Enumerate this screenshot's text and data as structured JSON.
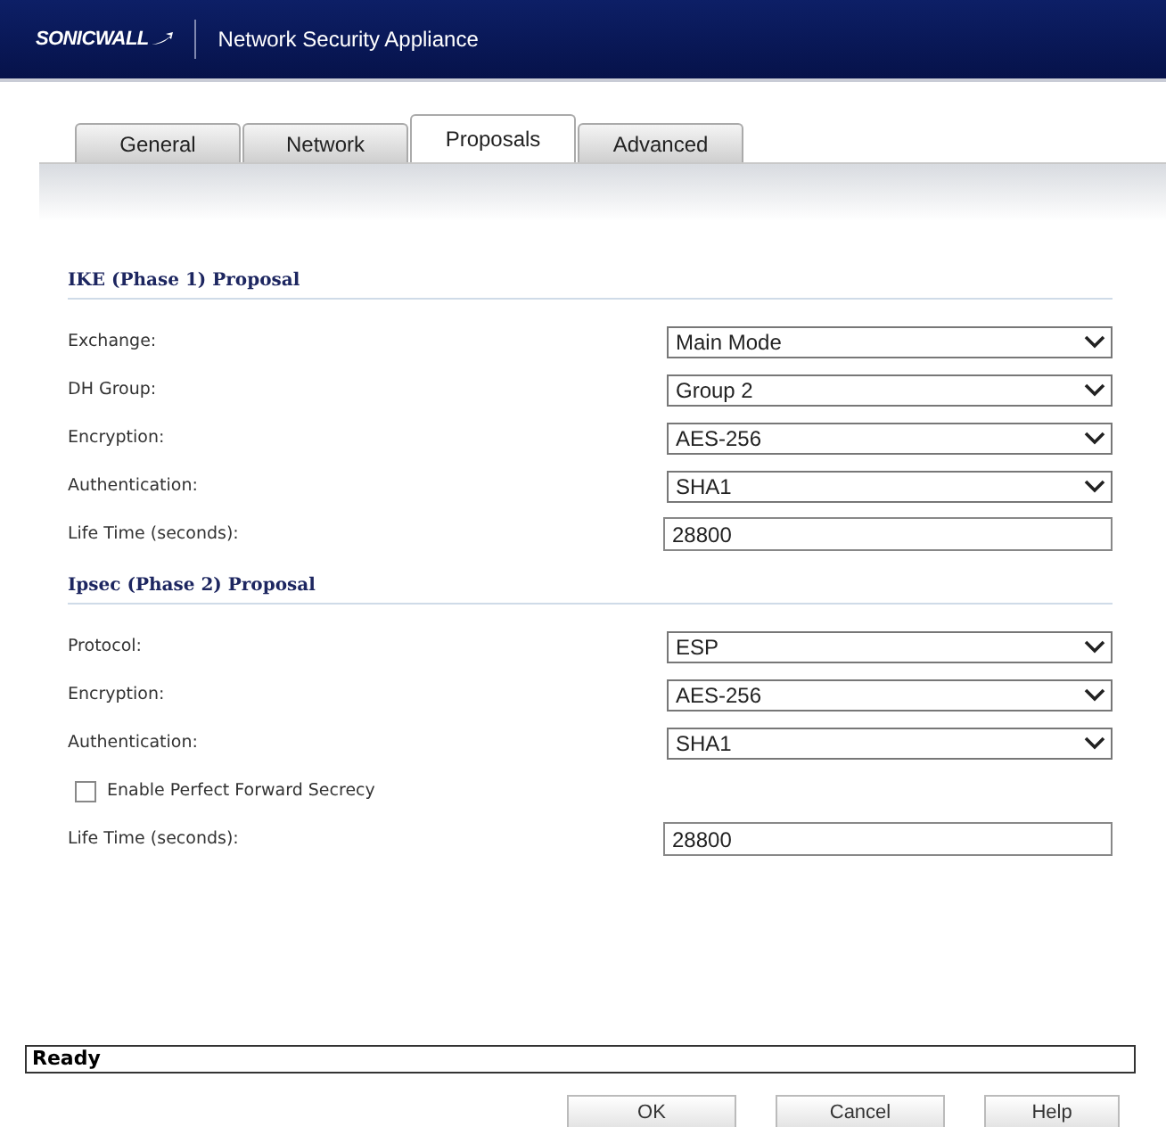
{
  "header": {
    "logo": "SONICWALL",
    "title": "Network Security Appliance"
  },
  "tabs": [
    {
      "label": "General",
      "selected": false
    },
    {
      "label": "Network",
      "selected": false
    },
    {
      "label": "Proposals",
      "selected": true
    },
    {
      "label": "Advanced",
      "selected": false
    }
  ],
  "sections": [
    {
      "title": "IKE (Phase 1) Proposal",
      "rows": [
        {
          "kind": "select",
          "label": "Exchange:",
          "value": "Main Mode"
        },
        {
          "kind": "select",
          "label": "DH Group:",
          "value": "Group 2"
        },
        {
          "kind": "select",
          "label": "Encryption:",
          "value": "AES-256"
        },
        {
          "kind": "select",
          "label": "Authentication:",
          "value": "SHA1"
        },
        {
          "kind": "input",
          "label": "Life Time (seconds):",
          "value": "28800"
        }
      ]
    },
    {
      "title": "Ipsec (Phase 2) Proposal",
      "rows": [
        {
          "kind": "select",
          "label": "Protocol:",
          "value": "ESP"
        },
        {
          "kind": "select",
          "label": "Encryption:",
          "value": "AES-256"
        },
        {
          "kind": "select",
          "label": "Authentication:",
          "value": "SHA1"
        },
        {
          "kind": "checkbox",
          "label": "Enable Perfect Forward Secrecy",
          "checked": false
        },
        {
          "kind": "input",
          "label": "Life Time (seconds):",
          "value": "28800"
        }
      ]
    }
  ],
  "status_bar": "Ready",
  "buttons": [
    "OK",
    "Cancel",
    "Help"
  ]
}
